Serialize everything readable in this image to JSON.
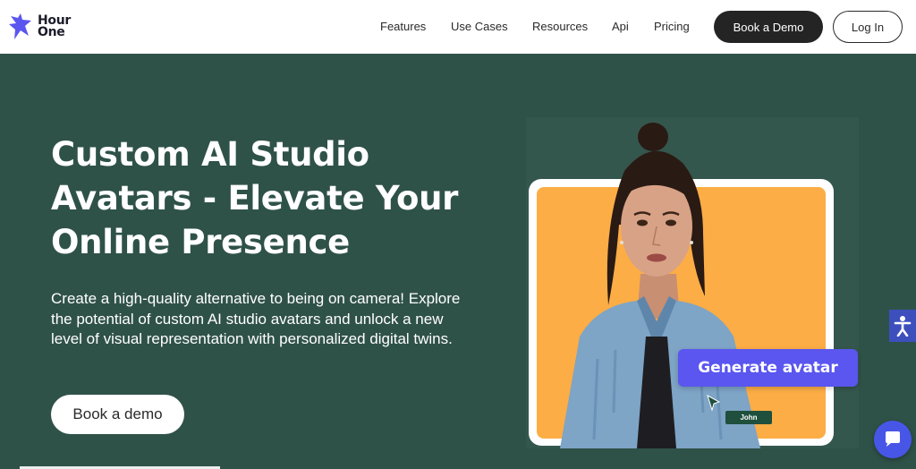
{
  "header": {
    "logo_line1": "Hour",
    "logo_line2": "One",
    "nav": [
      "Features",
      "Use Cases",
      "Resources",
      "Api",
      "Pricing"
    ],
    "book_demo_label": "Book a Demo",
    "login_label": "Log In"
  },
  "hero": {
    "title": "Custom AI Studio Avatars - Elevate Your Online Presence",
    "description": "Create a high-quality alternative to being on camera! Explore the potential of custom AI studio avatars and unlock a new level of visual representation with personalized digital twins.",
    "cta_label": "Book a demo"
  },
  "visual": {
    "generate_label": "Generate avatar",
    "name_tag": "John"
  },
  "colors": {
    "hero_bg": "#2f5248",
    "accent": "#5a56ef",
    "frame_orange": "#fcad45"
  },
  "icons": {
    "accessibility": "accessibility-icon",
    "chat": "chat-icon",
    "cursor": "cursor-icon"
  }
}
